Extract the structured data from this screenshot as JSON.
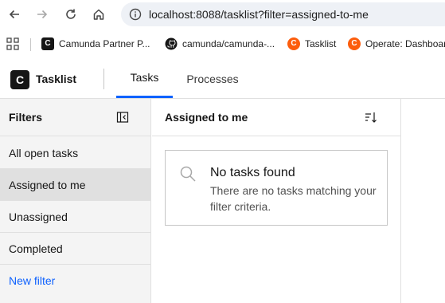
{
  "browser": {
    "url": "localhost:8088/tasklist?filter=assigned-to-me",
    "icons": [
      "back-icon",
      "forward-icon",
      "reload-icon",
      "home-icon",
      "info-icon"
    ]
  },
  "bookmarks": [
    {
      "label": "Camunda Partner P...",
      "icon": "camunda-icon"
    },
    {
      "label": "camunda/camunda-...",
      "icon": "github-icon"
    },
    {
      "label": "Tasklist",
      "icon": "camunda-orange-icon"
    },
    {
      "label": "Operate: Dashboard",
      "icon": "camunda-orange-icon"
    }
  ],
  "app": {
    "logo_letter": "C",
    "name": "Tasklist",
    "tabs": [
      {
        "label": "Tasks",
        "active": true
      },
      {
        "label": "Processes",
        "active": false
      }
    ],
    "accent_color": "#0f62fe"
  },
  "filters": {
    "title": "Filters",
    "items": [
      {
        "label": "All open tasks",
        "selected": false
      },
      {
        "label": "Assigned to me",
        "selected": true
      },
      {
        "label": "Unassigned",
        "selected": false
      },
      {
        "label": "Completed",
        "selected": false
      }
    ],
    "new_filter_label": "New filter"
  },
  "tasklist": {
    "title": "Assigned to me",
    "empty_title": "No tasks found",
    "empty_description": "There are no tasks matching your filter criteria."
  }
}
